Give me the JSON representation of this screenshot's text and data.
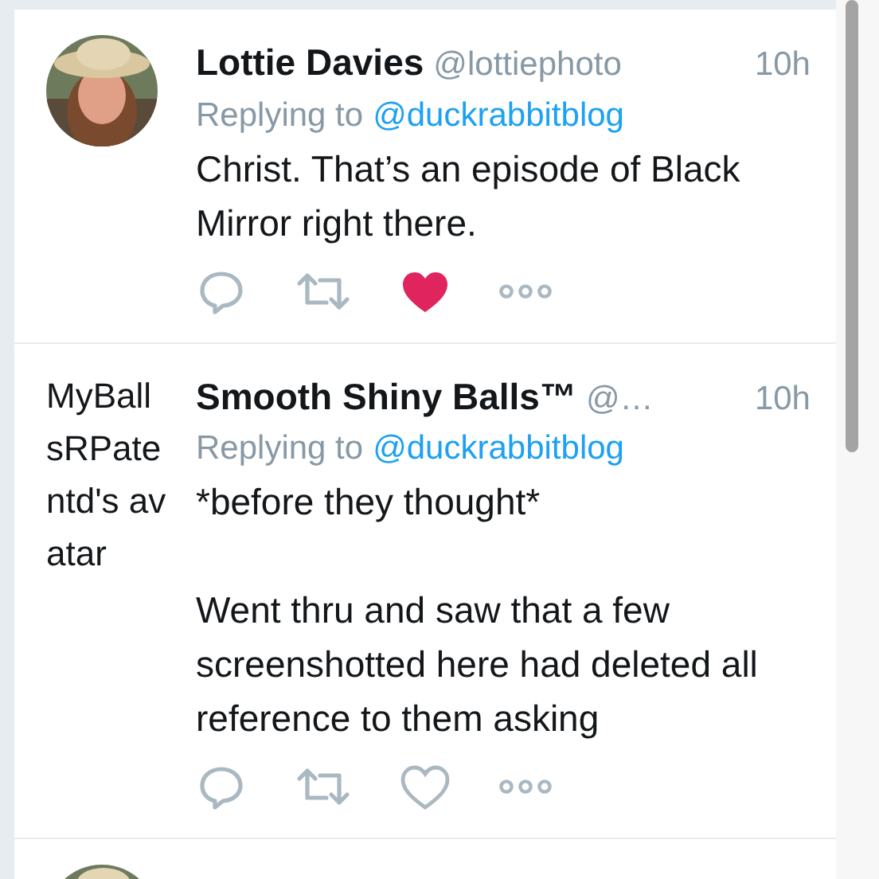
{
  "tweets": [
    {
      "avatar": {
        "kind": "picture"
      },
      "name": "Lottie Davies",
      "handle": "@lottiephoto",
      "time": "10h",
      "replying_label": "Replying to",
      "replying_to": "@duckrabbitblog",
      "paragraphs": [
        "Christ. That’s an episode of Black Mirror right there."
      ],
      "liked": true
    },
    {
      "avatar": {
        "kind": "alt_text",
        "text": "MyBallsRPatentd's avatar"
      },
      "name": "Smooth Shiny Balls™",
      "handle": "@…",
      "time": "10h",
      "replying_label": "Replying to",
      "replying_to": "@duckrabbitblog",
      "paragraphs": [
        "*before they thought*",
        "Went thru and saw that a few screenshotted here had deleted all reference to them asking"
      ],
      "liked": false
    },
    {
      "avatar": {
        "kind": "picture"
      }
    }
  ]
}
